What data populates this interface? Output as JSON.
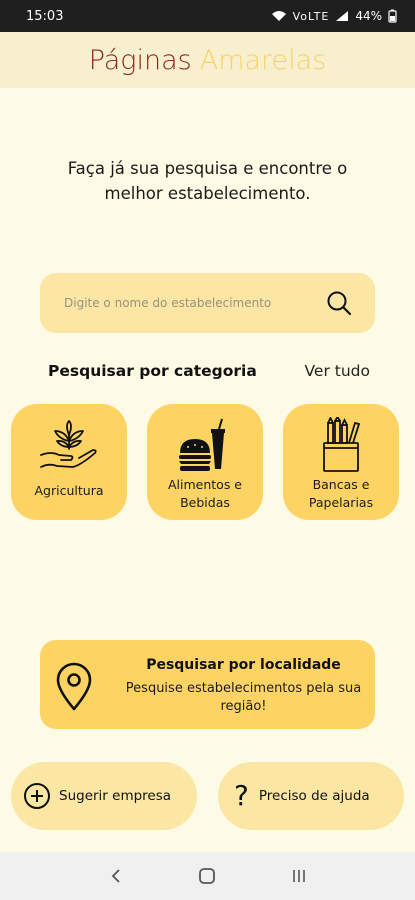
{
  "status_bar": {
    "time": "15:03",
    "signal": "VoLTE",
    "battery": "44%"
  },
  "header": {
    "title_part1": "Páginas",
    "title_part2": "Amarelas"
  },
  "intro_text": "Faça já sua pesquisa e encontre o melhor estabelecimento.",
  "search": {
    "placeholder": "Digite o nome do estabelecimento",
    "icon": "search-icon"
  },
  "categories": {
    "title": "Pesquisar por categoria",
    "see_all": "Ver tudo",
    "items": [
      {
        "label": "Agricultura",
        "icon": "plant-in-hand-icon"
      },
      {
        "label": "Alimentos e Bebidas",
        "icon": "burger-drink-icon"
      },
      {
        "label": "Bancas e Papelarias",
        "icon": "pencil-cup-icon"
      }
    ]
  },
  "location_card": {
    "title": "Pesquisar por localidade",
    "subtitle": "Pesquise estabelecimentos pela sua região!",
    "icon": "location-pin-icon"
  },
  "actions": {
    "suggest_label": "Sugerir empresa",
    "help_label": "Preciso de ajuda"
  },
  "colors": {
    "background": "#fdfbe6",
    "accent": "#fdd463",
    "accent_light": "#fbe7a3",
    "brand_red": "#8a2a1b"
  }
}
